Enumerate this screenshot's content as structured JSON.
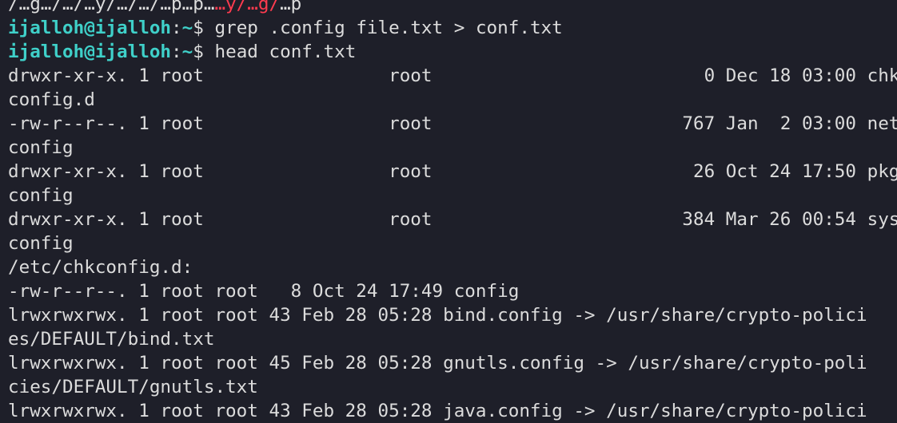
{
  "terminal": {
    "top_partial_prefix": "/…g…/…/…y/…/…/…p…p…",
    "top_partial_red": "…y/…g/",
    "top_partial_suffix": "…p",
    "prompt": {
      "user_host": "ijalloh@ijalloh",
      "colon": ":",
      "path": "~",
      "symbol": "$ "
    },
    "commands": [
      "grep .config file.txt > conf.txt",
      "head conf.txt"
    ],
    "output_lines": [
      "drwxr-xr-x. 1 root                 root                         0 Dec 18 03:00 chk",
      "config.d",
      "-rw-r--r--. 1 root                 root                       767 Jan  2 03:00 net",
      "config",
      "drwxr-xr-x. 1 root                 root                        26 Oct 24 17:50 pkg",
      "config",
      "drwxr-xr-x. 1 root                 root                       384 Mar 26 00:54 sys",
      "config",
      "/etc/chkconfig.d:",
      "-rw-r--r--. 1 root root   8 Oct 24 17:49 config",
      "lrwxrwxrwx. 1 root root 43 Feb 28 05:28 bind.config -> /usr/share/crypto-polici",
      "es/DEFAULT/bind.txt",
      "lrwxrwxrwx. 1 root root 45 Feb 28 05:28 gnutls.config -> /usr/share/crypto-poli",
      "cies/DEFAULT/gnutls.txt",
      "lrwxrwxrwx. 1 root root 43 Feb 28 05:28 java.config -> /usr/share/crypto-polici"
    ]
  }
}
